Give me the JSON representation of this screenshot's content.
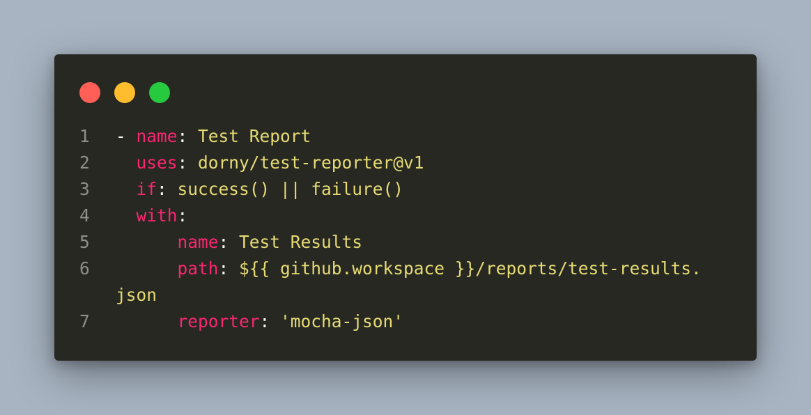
{
  "window": {
    "controls": [
      {
        "name": "close",
        "color": "#ff5f56"
      },
      {
        "name": "minimize",
        "color": "#ffbd2e"
      },
      {
        "name": "maximize",
        "color": "#27c93f"
      }
    ]
  },
  "code": {
    "language": "yaml",
    "lines": [
      {
        "num": "1",
        "indent": "",
        "dash": "- ",
        "key": "name",
        "sep": ": ",
        "value": "Test Report"
      },
      {
        "num": "2",
        "indent": "  ",
        "dash": "",
        "key": "uses",
        "sep": ": ",
        "value": "dorny/test-reporter@v1"
      },
      {
        "num": "3",
        "indent": "  ",
        "dash": "",
        "key": "if",
        "sep": ": ",
        "value": "success() || failure()"
      },
      {
        "num": "4",
        "indent": "  ",
        "dash": "",
        "key": "with",
        "sep": ":",
        "value": ""
      },
      {
        "num": "5",
        "indent": "      ",
        "dash": "",
        "key": "name",
        "sep": ": ",
        "value": "Test Results"
      },
      {
        "num": "6",
        "indent": "      ",
        "dash": "",
        "key": "path",
        "sep": ": ",
        "value": "${{ github.workspace }}/reports/test-results."
      },
      {
        "num": "",
        "indent": "",
        "dash": "",
        "key": "",
        "sep": "",
        "value": "json"
      },
      {
        "num": "7",
        "indent": "      ",
        "dash": "",
        "key": "reporter",
        "sep": ": ",
        "value": "'mocha-json'"
      }
    ]
  },
  "colors": {
    "background": "#a8b4c2",
    "editor_bg": "#272822",
    "key": "#f92672",
    "value": "#e6db74",
    "punct": "#f8f8f2",
    "gutter": "#8f908a"
  }
}
